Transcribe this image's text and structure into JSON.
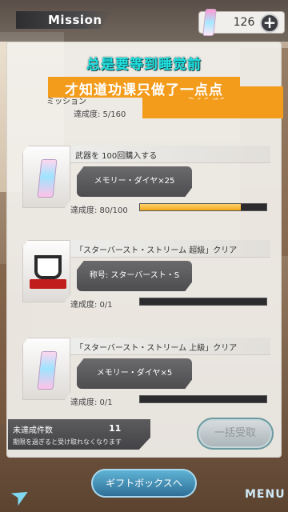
{
  "header": {
    "title": "Mission",
    "diamond_count": "126",
    "plus_label": "+"
  },
  "subtitle": {
    "line1": "总是要等到睡觉前",
    "line2": "才知道功课只做了一点点"
  },
  "partial_card": {
    "title_partial": "ミッション",
    "progress_label": "達成度: 5/160",
    "right_label": "ミッション"
  },
  "missions": [
    {
      "title": "武器を 100回購入する",
      "reward": "メモリー・ダイヤ×25",
      "progress_label": "達成度: 80/100",
      "progress": 0.8
    },
    {
      "title": "「スターバースト・ストリーム 超級」クリア",
      "reward": "称号: スターバースト・S",
      "progress_label": "達成度: 0/1",
      "progress": 0
    },
    {
      "title": "「スターバースト・ストリーム 上級」クリア",
      "reward": "メモリー・ダイヤ×5",
      "progress_label": "達成度: 0/1",
      "progress": 0
    }
  ],
  "summary": {
    "label": "未達成件数",
    "count": "11",
    "note": "期限を過ぎると受け取れなくなります"
  },
  "buttons": {
    "collect_all": "一括受取",
    "gift_box": "ギフトボックスへ",
    "menu": "MENU"
  },
  "colors": {
    "accent_orange": "#f39b1b",
    "subtitle_cyan": "#21e0e0",
    "progress_fill": "#f1a81e"
  },
  "icons": {
    "back": "back-arrow-icon",
    "diamond": "memory-diamond-icon",
    "trophy": "trophy-icon",
    "crystal": "crystal-icon"
  }
}
